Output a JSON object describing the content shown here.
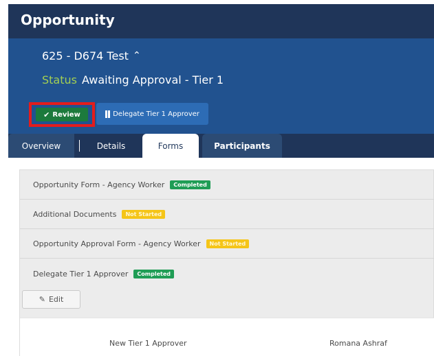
{
  "header": {
    "title": "Opportunity"
  },
  "opportunity": {
    "name": "625 - D674 Test",
    "status_label": "Status",
    "status_value": "Awaiting Approval - Tier 1"
  },
  "actions": {
    "review_label": "Review",
    "delegate_label": "Delegate Tier 1 Approver"
  },
  "tabs": [
    {
      "label": "Overview",
      "active": false
    },
    {
      "label": "Details",
      "active": false
    },
    {
      "label": "Forms",
      "active": true
    },
    {
      "label": "Participants",
      "active": false
    }
  ],
  "forms": [
    {
      "name": "Opportunity Form - Agency Worker",
      "status": "Completed"
    },
    {
      "name": "Additional Documents",
      "status": "Not Started"
    },
    {
      "name": "Opportunity Approval Form - Agency Worker",
      "status": "Not Started"
    },
    {
      "name": "Delegate Tier 1 Approver",
      "status": "Completed"
    }
  ],
  "edit_label": "Edit",
  "detail": {
    "label": "New Tier 1 Approver",
    "value": "Romana Ashraf"
  },
  "colors": {
    "header_bg": "#1f3559",
    "panel_bg": "#21528f",
    "status_label": "#a3cf52",
    "review_button": "#1c7a3c",
    "delegate_button": "#2d6cb5",
    "highlight_border": "#e41c1c",
    "badge_completed": "#1f9d55",
    "badge_not_started": "#f5c518"
  }
}
